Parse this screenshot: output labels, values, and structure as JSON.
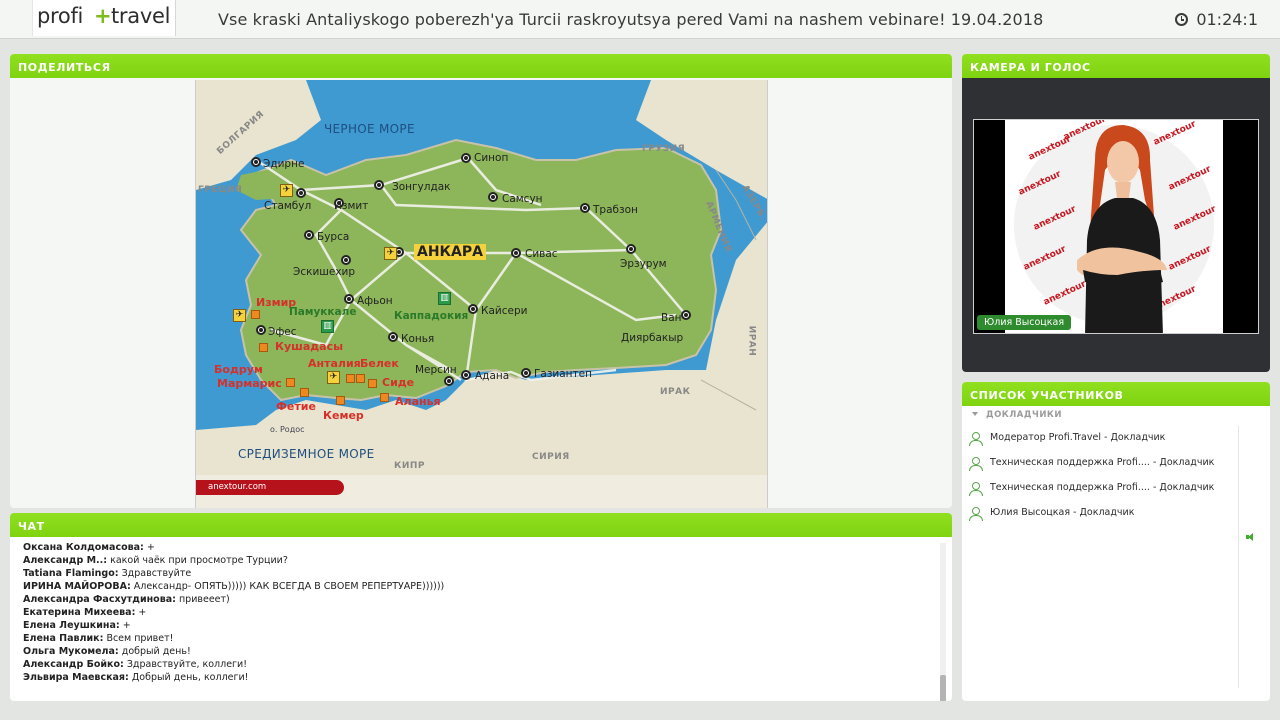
{
  "header": {
    "logo": {
      "word1": "profi",
      "plus": "+",
      "word2": "travel"
    },
    "title": "Vse kraski Antaliyskogo poberezh'ya Turcii raskroyutsya pered Vami na nashem  vebinare! 19.04.2018",
    "timer": "01:24:1"
  },
  "share_panel": {
    "heading": "ПОДЕЛИТЬСЯ",
    "map": {
      "seas": {
        "black_sea": "ЧЕРНОЕ МОРЕ",
        "med_sea": "СРЕДИЗЕМНОЕ МОРЕ"
      },
      "countries": {
        "bulgaria": "БОЛГАРИЯ",
        "greece": "ГРЕЦИЯ",
        "georgia": "ГРУЗИЯ",
        "armenia": "АРМЕНИЯ",
        "azerb": "АЗЕРБ.",
        "iran": "ИРАН",
        "iraq": "ИРАК",
        "syria": "СИРИЯ",
        "cyprus": "КИПР"
      },
      "capital": "АНКАРА",
      "cities": {
        "edirne": "Эдирне",
        "istanbul": "Стамбул",
        "izmit": "Измит",
        "zonguldak": "Зонгулдак",
        "sinop": "Синоп",
        "samsun": "Самсун",
        "trabzon": "Трабзон",
        "bursa": "Бурса",
        "eskisehir": "Эскишехир",
        "sivas": "Сивас",
        "erzurum": "Эрзурум",
        "afyon": "Афьон",
        "kayseri": "Кайсери",
        "van": "Ван",
        "efes": "Эфес",
        "konya": "Конья",
        "diyarbakir": "Диярбакыр",
        "mersin": "Мерсин",
        "adana": "Адана",
        "gaziantep": "Газиантеп",
        "rodos": "о. Родос"
      },
      "resorts": {
        "izmir": "Измир",
        "kusadasi": "Кушадасы",
        "antalya": "Анталия",
        "belek": "Белек",
        "bodrum": "Бодрум",
        "marmaris": "Мармарис",
        "side": "Сиде",
        "fethiye": "Фетие",
        "alanya": "Аланья",
        "kemer": "Кемер"
      },
      "sights": {
        "pamukkale": "Памуккале",
        "cappadocia": "Каппадокия"
      },
      "brand": "anextour.com"
    }
  },
  "chat_panel": {
    "heading": "ЧАТ",
    "messages": [
      {
        "author": "Оксана Колдомасова:",
        "text": " +"
      },
      {
        "author": "Александр М..:",
        "text": " какой чаёк при просмотре Турции?"
      },
      {
        "author": "Tatiana Flamingo:",
        "text": " Здравствуйте"
      },
      {
        "author": "ИРИНА МАЙОРОВА:",
        "text": " Александр- ОПЯТЬ))))) КАК ВСЕГДА В СВОЕМ РЕПЕРТУАРЕ))))))"
      },
      {
        "author": "Александра Фасхутдинова:",
        "text": " привееет)"
      },
      {
        "author": "Екатерина Михеева:",
        "text": " +"
      },
      {
        "author": "Елена Леушкина:",
        "text": " +"
      },
      {
        "author": "Елена Павлик:",
        "text": " Всем привет!"
      },
      {
        "author": "Ольга Мукомела:",
        "text": " добрый день!"
      },
      {
        "author": "Александр Бойко:",
        "text": " Здравствуйте, коллеги!"
      },
      {
        "author": "Эльвира Маевская:",
        "text": " Добрый день, коллеги!"
      }
    ]
  },
  "camera_panel": {
    "heading": "КАМЕРА И ГОЛОС",
    "speaker_name": "Юлия Высоцкая",
    "backdrop_text": "anextour"
  },
  "participants_panel": {
    "heading": "СПИСОК УЧАСТНИКОВ",
    "group_label": "ДОКЛАДЧИКИ",
    "participants": [
      {
        "name": "Модератор Profi.Travel  - Докладчик"
      },
      {
        "name": "Техническая поддержка Profi....  - Докладчик"
      },
      {
        "name": "Техническая поддержка Profi....  - Докладчик"
      },
      {
        "name": "Юлия Высоцкая  - Докладчик"
      }
    ]
  }
}
